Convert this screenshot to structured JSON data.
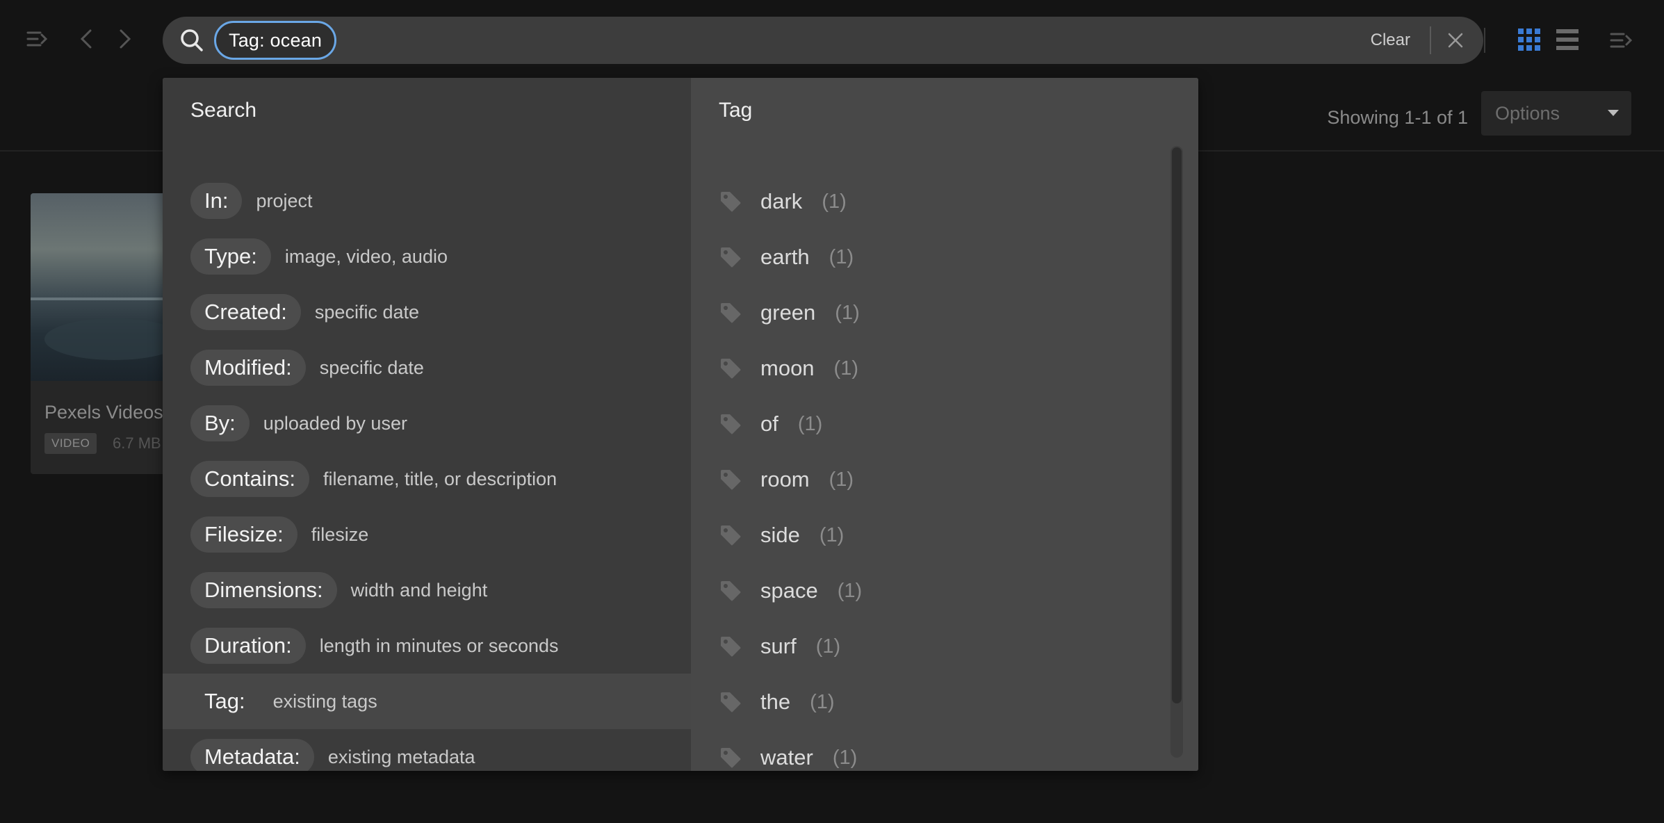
{
  "search": {
    "chip_text": "Tag: ocean",
    "clear_label": "Clear"
  },
  "header": {
    "showing": "Showing 1-1 of 1",
    "options_label": "Options"
  },
  "card": {
    "title": "Pexels Videos",
    "badge": "VIDEO",
    "size": "6.7 MB"
  },
  "dropdown": {
    "search_heading": "Search",
    "tag_heading": "Tag",
    "filters": [
      {
        "label": "In:",
        "desc": "project"
      },
      {
        "label": "Type:",
        "desc": "image, video, audio"
      },
      {
        "label": "Created:",
        "desc": "specific date"
      },
      {
        "label": "Modified:",
        "desc": "specific date"
      },
      {
        "label": "By:",
        "desc": "uploaded by user"
      },
      {
        "label": "Contains:",
        "desc": "filename, title, or description"
      },
      {
        "label": "Filesize:",
        "desc": "filesize"
      },
      {
        "label": "Dimensions:",
        "desc": "width and height"
      },
      {
        "label": "Duration:",
        "desc": "length in minutes or seconds"
      },
      {
        "label": "Tag:",
        "desc": "existing tags"
      },
      {
        "label": "Metadata:",
        "desc": "existing metadata"
      }
    ],
    "tags": [
      {
        "name": "dark",
        "count": "(1)"
      },
      {
        "name": "earth",
        "count": "(1)"
      },
      {
        "name": "green",
        "count": "(1)"
      },
      {
        "name": "moon",
        "count": "(1)"
      },
      {
        "name": "of",
        "count": "(1)"
      },
      {
        "name": "room",
        "count": "(1)"
      },
      {
        "name": "side",
        "count": "(1)"
      },
      {
        "name": "space",
        "count": "(1)"
      },
      {
        "name": "surf",
        "count": "(1)"
      },
      {
        "name": "the",
        "count": "(1)"
      },
      {
        "name": "water",
        "count": "(1)"
      }
    ]
  },
  "icons": {
    "sidebar_toggle": "sidebar-toggle-icon",
    "back": "chevron-left-icon",
    "forward": "chevron-right-icon",
    "search": "search-icon",
    "close": "close-icon",
    "grid_view": "grid-view-icon",
    "list_view": "list-view-icon",
    "panel_toggle": "panel-toggle-icon",
    "tag": "tag-icon"
  },
  "colors": {
    "accent": "#6aa7e6",
    "grid_active": "#3a7bd5"
  }
}
